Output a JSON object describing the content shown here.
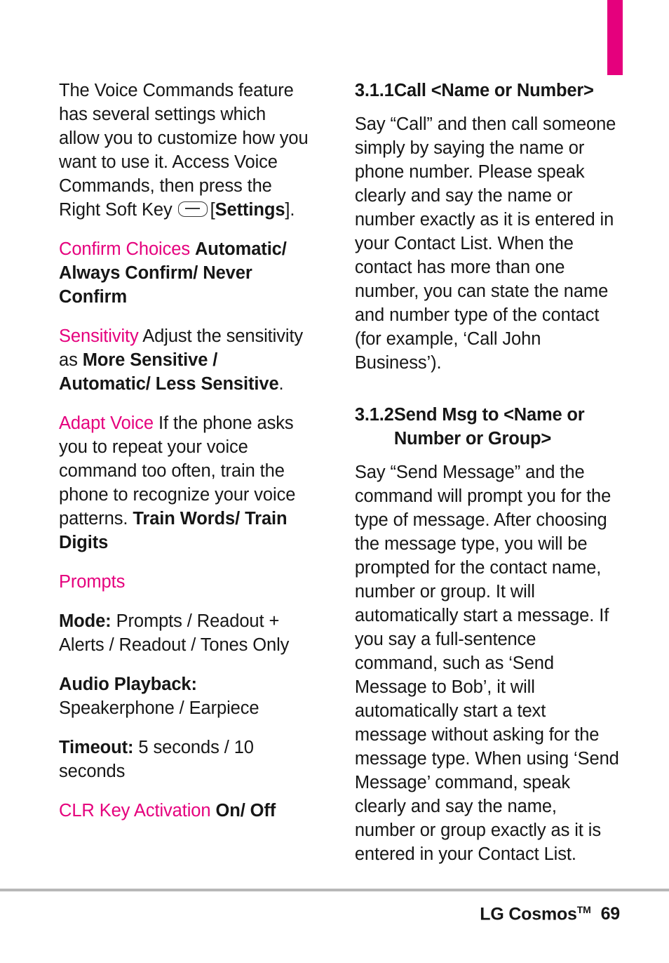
{
  "page": {
    "number": "69",
    "footer_brand": "LG Cosmos",
    "footer_tm": "TM"
  },
  "left_column": {
    "intro": {
      "part1": "The Voice Commands feature has several settings which allow you to customize how you want to use it. Access Voice Commands, then press the Right Soft Key",
      "softkey_icon": "soft-key-icon",
      "part2": "[",
      "bold": "Settings",
      "part3": "]."
    },
    "settings": [
      {
        "term": "Confirm Choices",
        "term_style": "pink",
        "body_bold": "Automatic/ Always Confirm/ Never Confirm",
        "body_plain": ""
      },
      {
        "term": "Sensitivity",
        "term_style": "pink",
        "body_plain": "Adjust the sensitivity as",
        "body_bold": "More Sensitive / Automatic/ Less Sensitive",
        "body_tail": "."
      },
      {
        "term": "Adapt Voice",
        "term_style": "pink",
        "body_plain": "If the phone asks you to repeat your voice command too often, train the phone to recognize your voice patterns.",
        "body_bold": "Train Words/ Train Digits"
      },
      {
        "term": "Prompts",
        "term_style": "pink",
        "body_plain": "",
        "body_bold": ""
      }
    ],
    "prompt_options": [
      {
        "label": "Mode:",
        "value": "Prompts / Readout + Alerts / Readout / Tones Only"
      },
      {
        "label": "Audio Playback:",
        "value": "Speakerphone / Earpiece"
      },
      {
        "label": "Timeout:",
        "value": "5 seconds / 10 seconds"
      }
    ],
    "clr": {
      "term": "CLR Key Activation",
      "value": "On/ Off"
    }
  },
  "right_column": {
    "section1": {
      "number": "3.1.1",
      "title": "Call <Name or Number>",
      "body": "Say “Call” and then call someone simply by saying the name or phone number. Please speak clearly and say the name or number exactly as it is entered in your Contact List. When the contact has more than one number, you can state the name and number type of the contact (for example, ‘Call John Business’)."
    },
    "section2": {
      "number": "3.1.2",
      "title_line1": "Send Msg to <Name or",
      "title_line2": "Number or Group>",
      "body": "Say “Send Message” and the command will prompt you for the type of message. After choosing the message type, you will be prompted for the contact name, number or group. It will automatically start a message. If you say a full-sentence command, such as ‘Send Message to Bob’, it will automatically start a text message without asking for the message type. When using ‘Send Message’ command, speak clearly and say the name, number or group exactly as it is entered in your Contact List."
    }
  },
  "colors": {
    "accent": "#e5007d",
    "text": "#161616",
    "rule": "#b8b8b8"
  }
}
